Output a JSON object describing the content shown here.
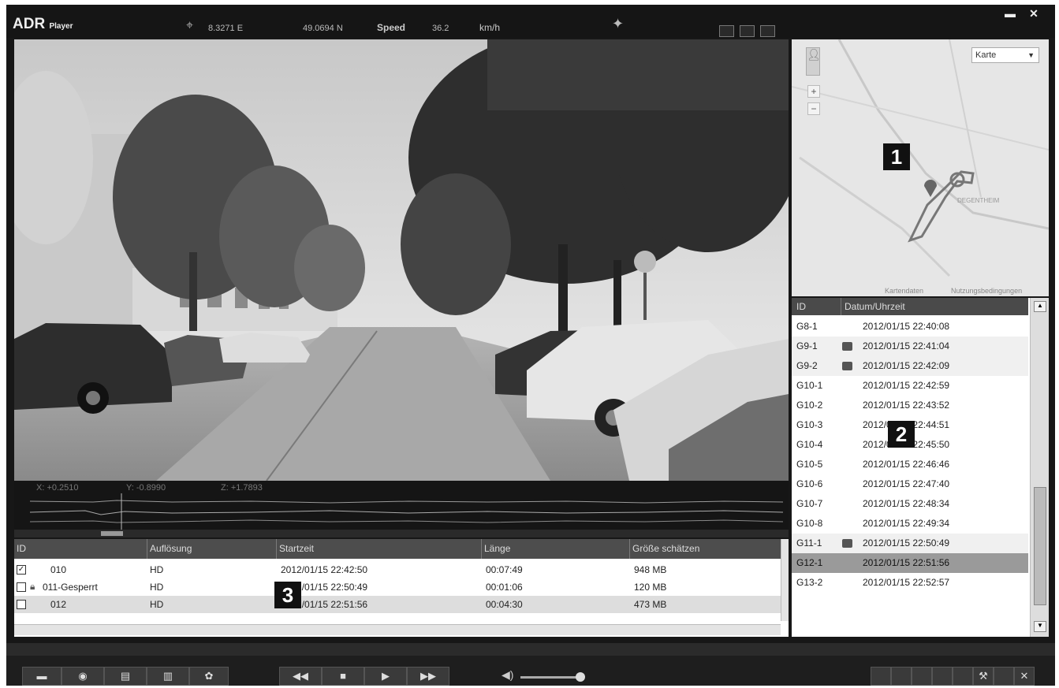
{
  "app": {
    "name": "ADR",
    "sub": "Player"
  },
  "gps": {
    "lon": "8.3271 E",
    "lat": "49.0694 N",
    "speed_label": "Speed",
    "speed": "36.2",
    "speed_unit": "km/h"
  },
  "sensor": {
    "x": "X: +0.2510",
    "y": "Y: -0.8990",
    "z": "Z: +1.7893"
  },
  "map": {
    "type_label": "Karte",
    "attribution": "Kartendaten",
    "terms": "Nutzungsbedingungen",
    "place": "DEGENTHEIM"
  },
  "list": {
    "headers": {
      "id": "ID",
      "datetime": "Datum/Uhrzeit"
    },
    "rows": [
      {
        "id": "G8-1",
        "dt": "2012/01/15  22:40:08",
        "icon": false
      },
      {
        "id": "G9-1",
        "dt": "2012/01/15  22:41:04",
        "icon": true
      },
      {
        "id": "G9-2",
        "dt": "2012/01/15  22:42:09",
        "icon": true
      },
      {
        "id": "G10-1",
        "dt": "2012/01/15  22:42:59",
        "icon": false
      },
      {
        "id": "G10-2",
        "dt": "2012/01/15  22:43:52",
        "icon": false
      },
      {
        "id": "G10-3",
        "dt": "2012/01/15  22:44:51",
        "icon": false
      },
      {
        "id": "G10-4",
        "dt": "2012/01/15  22:45:50",
        "icon": false
      },
      {
        "id": "G10-5",
        "dt": "2012/01/15  22:46:46",
        "icon": false
      },
      {
        "id": "G10-6",
        "dt": "2012/01/15  22:47:40",
        "icon": false
      },
      {
        "id": "G10-7",
        "dt": "2012/01/15  22:48:34",
        "icon": false
      },
      {
        "id": "G10-8",
        "dt": "2012/01/15  22:49:34",
        "icon": false
      },
      {
        "id": "G11-1",
        "dt": "2012/01/15  22:50:49",
        "icon": true
      },
      {
        "id": "G12-1",
        "dt": "2012/01/15  22:51:56",
        "icon": false
      },
      {
        "id": "G13-2",
        "dt": "2012/01/15  22:52:57",
        "icon": false
      }
    ],
    "selected_index": 12
  },
  "clips": {
    "headers": {
      "id": "ID",
      "res": "Auflösung",
      "start": "Startzeit",
      "len": "Länge",
      "size": "Größe schätzen"
    },
    "rows": [
      {
        "id": "010",
        "res": "HD",
        "start": "2012/01/15 22:42:50",
        "len": "00:07:49",
        "size": "948 MB",
        "checked": true
      },
      {
        "id": "011-Gesperrt",
        "res": "HD",
        "start": "2012/01/15 22:50:49",
        "len": "00:01:06",
        "size": "120 MB",
        "checked": false
      },
      {
        "id": "012",
        "res": "HD",
        "start": "2012/01/15 22:51:56",
        "len": "00:04:30",
        "size": "473 MB",
        "checked": false
      }
    ]
  },
  "callouts": {
    "c1": "1",
    "c2": "2",
    "c3": "3"
  }
}
